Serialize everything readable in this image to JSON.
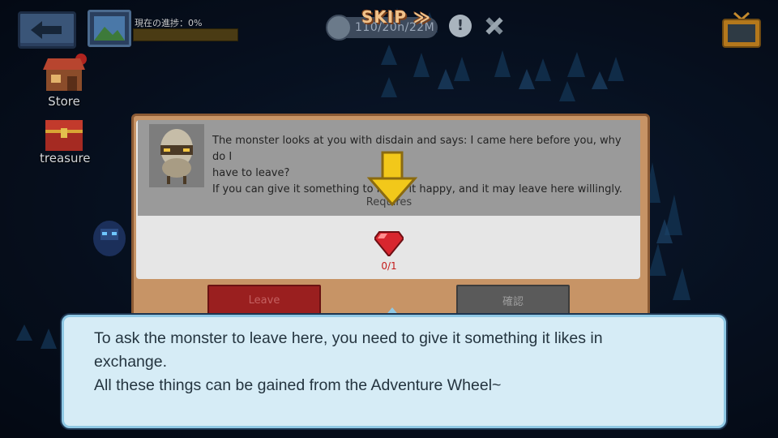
{
  "header": {
    "progress_label": "現在の進捗：0%",
    "progress": 0,
    "timer": "110/20h/22M",
    "skip_label": "SKIP ≫"
  },
  "sidebar": {
    "items": [
      {
        "label": "Store",
        "icon": "store-icon"
      },
      {
        "label": "treasure",
        "icon": "treasure-chest-icon"
      }
    ]
  },
  "dialog": {
    "message_lines": [
      "The monster looks at you with disdain and says: I came here before you, why do I",
      "have to leave?",
      "If you can give it something to make it happy, and it may leave here willingly."
    ],
    "requires_label": "Requires",
    "item_count": "0/1",
    "leave_label": "Leave",
    "confirm_label": "確認"
  },
  "tooltip": {
    "lines": [
      "To ask the monster to leave here, you need to give it something it likes in",
      "exchange.",
      "All these things can be gained from the Adventure Wheel~"
    ]
  },
  "colors": {
    "panel": "#c79466",
    "leave_button": "#9a1f1f",
    "tooltip_bg": "#d6ecf6",
    "highlight_arrow": "#f2c81a"
  }
}
